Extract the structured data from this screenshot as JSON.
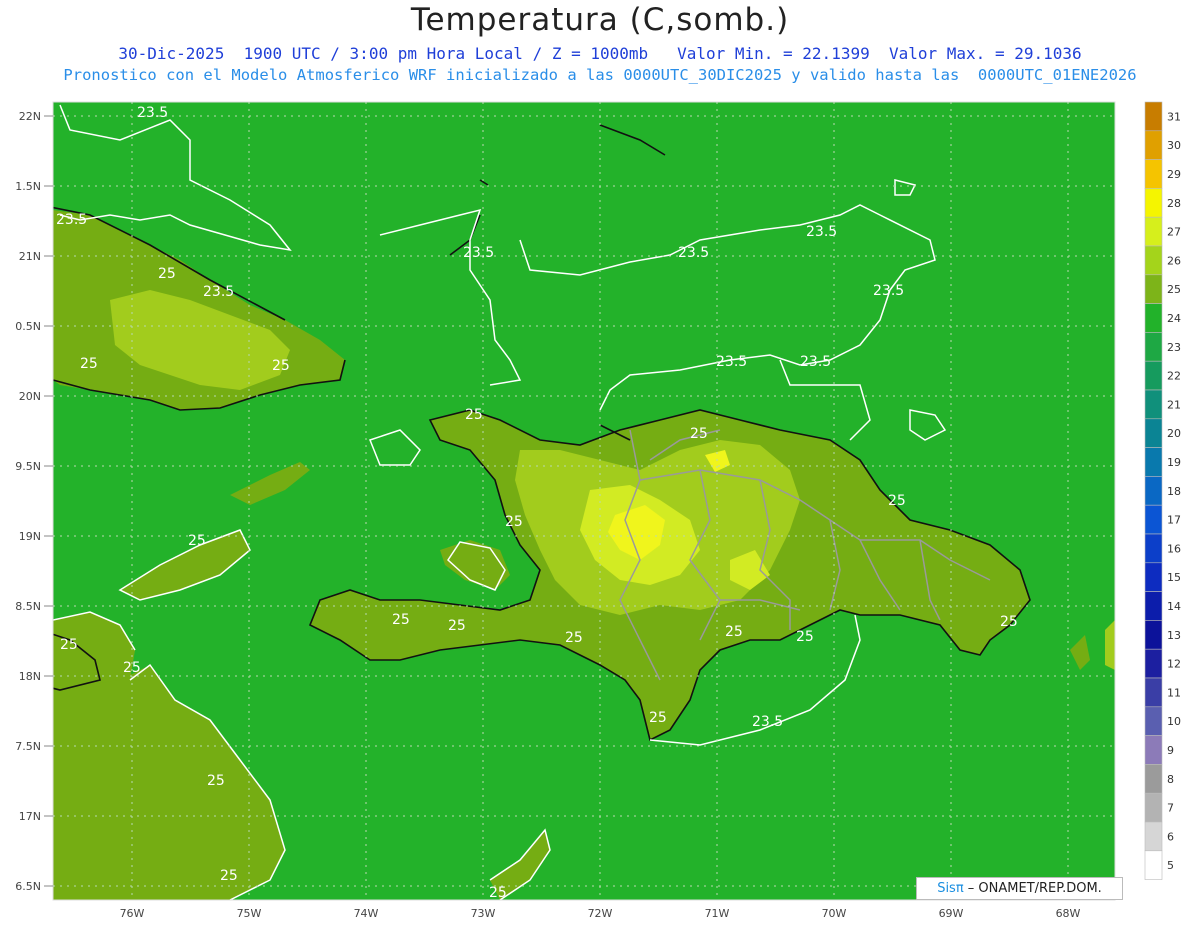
{
  "header": {
    "title": "Temperatura (C,somb.)",
    "subtitle_line1": "30-Dic-2025  1900 UTC / 3:00 pm Hora Local / Z = 1000mb   Valor Min. = 22.1399  Valor Max. = 29.1036",
    "subtitle_line2": "Pronostico con el Modelo Atmosferico WRF inicializado a las 0000UTC_30DIC2025 y valido hasta las  0000UTC_01ENE2026"
  },
  "map": {
    "lat_labels": [
      "22N",
      "1.5N",
      "21N",
      "0.5N",
      "20N",
      "9.5N",
      "19N",
      "8.5N",
      "18N",
      "7.5N",
      "17N",
      "6.5N"
    ],
    "lon_labels": [
      "76W",
      "75W",
      "74W",
      "73W",
      "72W",
      "71W",
      "70W",
      "69W",
      "68W"
    ],
    "contour_labels": [
      {
        "text": "23.5"
      },
      {
        "text": "23.5"
      },
      {
        "text": "23.5"
      },
      {
        "text": "23.5"
      },
      {
        "text": "23.5"
      },
      {
        "text": "23.5"
      },
      {
        "text": "23.5"
      },
      {
        "text": "23.5"
      },
      {
        "text": "23.5"
      },
      {
        "text": "23.5"
      },
      {
        "text": "25"
      },
      {
        "text": "25"
      },
      {
        "text": "25"
      },
      {
        "text": "25"
      },
      {
        "text": "25"
      },
      {
        "text": "25"
      },
      {
        "text": "25"
      },
      {
        "text": "25"
      },
      {
        "text": "25"
      },
      {
        "text": "25"
      },
      {
        "text": "25"
      },
      {
        "text": "25"
      },
      {
        "text": "25"
      },
      {
        "text": "25"
      },
      {
        "text": "25"
      },
      {
        "text": "25"
      },
      {
        "text": "25"
      },
      {
        "text": "25"
      },
      {
        "text": "25"
      },
      {
        "text": "25"
      }
    ],
    "colors": {
      "background_field": "#23b22a",
      "warm_land": "#75ad13",
      "warmer": "#a2cc1d",
      "hot": "#d2eb23",
      "hottest": "#f0f51c",
      "contour_line": "#ffffff",
      "coast": "#111111",
      "border": "#9a9a9a"
    }
  },
  "colorbar": {
    "labels": [
      "31",
      "30",
      "29",
      "28",
      "27",
      "26",
      "25",
      "24",
      "23",
      "22",
      "21",
      "20",
      "19",
      "18",
      "17",
      "16",
      "15",
      "14",
      "13",
      "12",
      "11",
      "10",
      "9",
      "8",
      "7",
      "6",
      "5"
    ],
    "colors": [
      "#c87d00",
      "#e0a000",
      "#f5c400",
      "#f5f500",
      "#d6ef1c",
      "#a4d41b",
      "#7db419",
      "#22b22a",
      "#1ea844",
      "#169b5e",
      "#10907b",
      "#0b8494",
      "#0979ad",
      "#0a68c4",
      "#0b55d4",
      "#0c3fc9",
      "#0d2cc0",
      "#0c1dab",
      "#0c129a",
      "#1c1fa0",
      "#3a3ea6",
      "#5a5fb0",
      "#8c7bb8",
      "#9b9b9b",
      "#b3b3b3",
      "#d6d6d6",
      "#ffffff"
    ]
  },
  "credit": {
    "sis": "Sisπ",
    "text": " – ONAMET/REP.DOM."
  }
}
